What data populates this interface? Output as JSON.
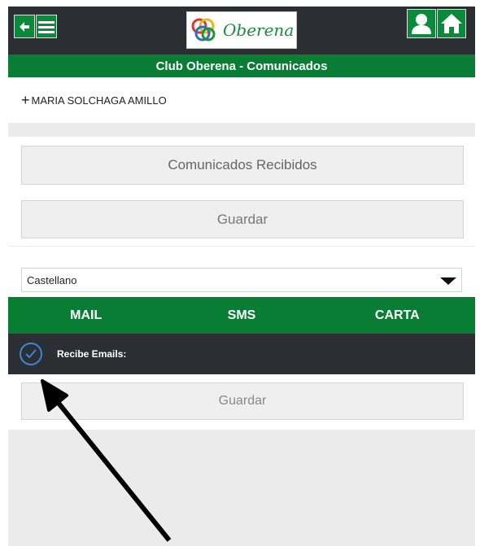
{
  "header": {
    "logo_text": "Oberena",
    "back_icon": "arrow-left-icon",
    "menu_icon": "hamburger-icon",
    "user_icon": "user-icon",
    "home_icon": "home-icon"
  },
  "title": "Club Oberena - Comunicados",
  "person": {
    "name": "MARIA SOLCHAGA AMILLO",
    "expand_symbol": "+"
  },
  "buttons": {
    "received": "Comunicados Recibidos",
    "save_top": "Guardar",
    "save_bottom": "Guardar"
  },
  "language_select": {
    "value": "Castellano"
  },
  "tabs": [
    {
      "label": "MAIL"
    },
    {
      "label": "SMS"
    },
    {
      "label": "CARTA"
    }
  ],
  "email_option": {
    "label": "Recibe Emails:",
    "checked": true
  },
  "colors": {
    "brand_green": "#0a7d35",
    "dark_bar": "#2b2e33",
    "check_blue": "#3d86d8"
  }
}
